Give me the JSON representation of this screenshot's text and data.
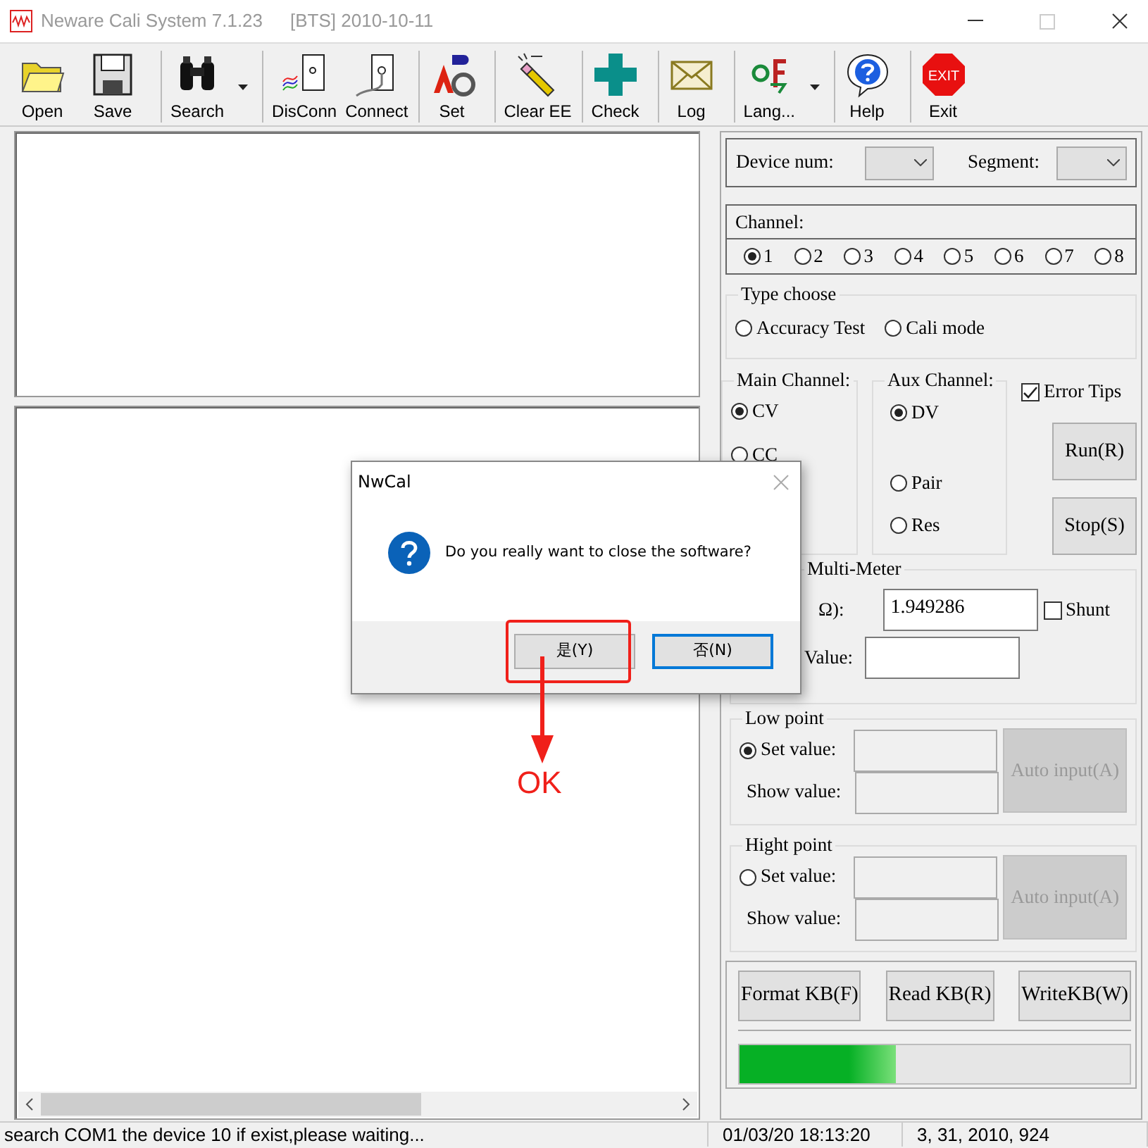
{
  "window": {
    "title": "Neware Cali System 7.1.23",
    "subtitle": "[BTS] 2010-10-11"
  },
  "toolbar": [
    {
      "label": "Open",
      "kind": "open",
      "has_menu": false,
      "separator_before": false
    },
    {
      "label": "Save",
      "kind": "save",
      "has_menu": false,
      "separator_before": false
    },
    {
      "label": "Search",
      "kind": "search",
      "has_menu": true,
      "separator_before": true
    },
    {
      "label": "DisConn",
      "kind": "disconnect",
      "has_menu": false,
      "separator_before": true
    },
    {
      "label": "Connect",
      "kind": "connect",
      "has_menu": false,
      "separator_before": false
    },
    {
      "label": "Set",
      "kind": "set",
      "has_menu": false,
      "separator_before": true
    },
    {
      "label": "Clear EE",
      "kind": "clear",
      "has_menu": false,
      "separator_before": true
    },
    {
      "label": "Check",
      "kind": "check",
      "has_menu": false,
      "separator_before": true
    },
    {
      "label": "Log",
      "kind": "log",
      "has_menu": false,
      "separator_before": true
    },
    {
      "label": "Lang...",
      "kind": "language",
      "has_menu": true,
      "separator_before": true
    },
    {
      "label": "Help",
      "kind": "help",
      "has_menu": false,
      "separator_before": true
    },
    {
      "label": "Exit",
      "kind": "exit",
      "badge_text": "EXIT",
      "has_menu": false,
      "separator_before": true
    }
  ],
  "right_panel": {
    "device_num_label": "Device num:",
    "segment_label": "Segment:",
    "channel_label": "Channel:",
    "channels": [
      {
        "label": "1",
        "selected": true
      },
      {
        "label": "2",
        "selected": false
      },
      {
        "label": "3",
        "selected": false
      },
      {
        "label": "4",
        "selected": false
      },
      {
        "label": "5",
        "selected": false
      },
      {
        "label": "6",
        "selected": false
      },
      {
        "label": "7",
        "selected": false
      },
      {
        "label": "8",
        "selected": false
      }
    ],
    "type_choose": {
      "title": "Type choose",
      "options": [
        {
          "label": "Accuracy Test",
          "selected": false
        },
        {
          "label": "Cali mode",
          "selected": false
        }
      ]
    },
    "main_channel": {
      "title": "Main Channel:",
      "options": [
        {
          "label": "CV",
          "selected": true
        },
        {
          "label": "CC",
          "selected": false
        }
      ]
    },
    "aux_channel": {
      "title": "Aux Channel:",
      "options": [
        {
          "label": "DV",
          "selected": true
        },
        {
          "label": "Pair",
          "selected": false
        },
        {
          "label": "Res",
          "selected": false
        }
      ]
    },
    "error_tips": {
      "label": "Error Tips",
      "checked": true
    },
    "run_button": "Run(R)",
    "stop_button": "Stop(S)",
    "multi_meter": {
      "title": "Multi-Meter",
      "resistor_label": "Ω):",
      "resistor_value": "1.949286",
      "shunt": {
        "label": "Shunt",
        "checked": false
      },
      "value_label": "Value:"
    },
    "low_point": {
      "title": "Low point",
      "set_label": "Set value:",
      "selected": true,
      "show_label": "Show value:",
      "auto_button": {
        "label": "Auto input(A)",
        "disabled": true
      }
    },
    "high_point": {
      "title": "Hight point",
      "set_label": "Set value:",
      "selected": false,
      "show_label": "Show value:",
      "auto_button": {
        "label": "Auto input(A)",
        "disabled": true
      }
    },
    "kb_buttons": [
      "Format KB(F)",
      "Read KB(R)",
      "WriteKB(W)"
    ],
    "progress": {
      "level": 0.4
    }
  },
  "status_bar": [
    "search COM1 the device 10 if exist,please waiting...",
    "01/03/20 18:13:20",
    "3, 31, 2010, 924"
  ],
  "dialog": {
    "title": "NwCal",
    "message": "Do you really want to close the software?",
    "buttons": [
      {
        "label": "是(Y)",
        "focused": false
      },
      {
        "label": "否(N)",
        "focused": true
      }
    ]
  },
  "annotation": {
    "label": "OK"
  }
}
